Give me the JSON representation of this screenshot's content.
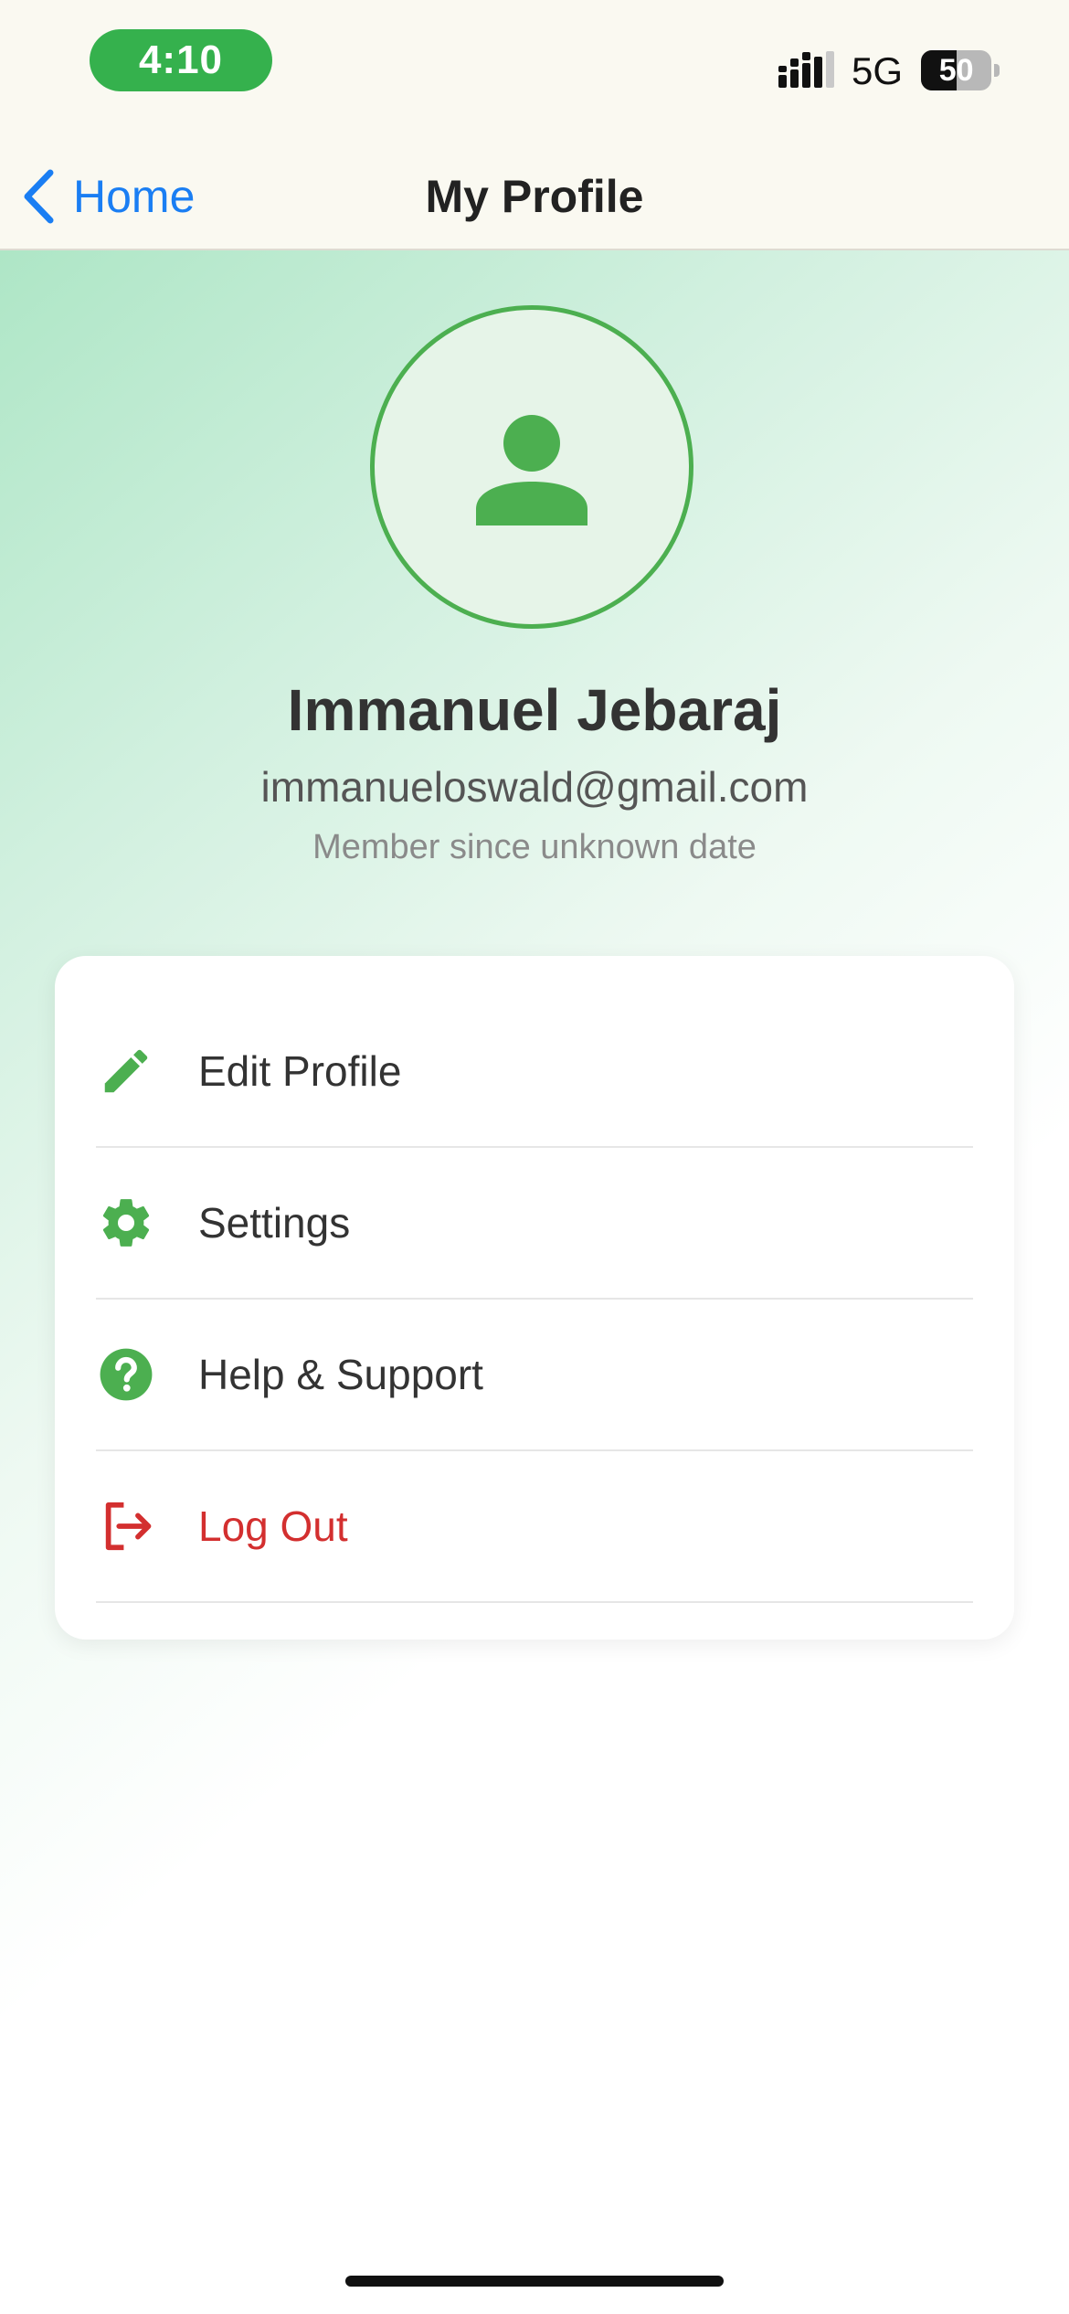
{
  "status_bar": {
    "time": "4:10",
    "network": "5G",
    "battery_level": "50",
    "battery_fraction": 0.5,
    "signal_icon": "cellular-signal-icon",
    "time_pill_color": "#35b14d"
  },
  "nav": {
    "back_label": "Home",
    "back_icon": "chevron-left-icon",
    "title": "My Profile",
    "accent_color": "#1a7ef3"
  },
  "profile": {
    "avatar_icon": "person-icon",
    "name": "Immanuel Jebaraj",
    "email": "immanueloswald@gmail.com",
    "member_since": "Member since unknown date",
    "brand_color": "#4caf50"
  },
  "menu": {
    "items": [
      {
        "label": "Edit Profile",
        "icon": "pencil-icon",
        "color": "#4caf50"
      },
      {
        "label": "Settings",
        "icon": "gear-icon",
        "color": "#4caf50"
      },
      {
        "label": "Help & Support",
        "icon": "help-circle-icon",
        "color": "#4caf50"
      },
      {
        "label": "Log Out",
        "icon": "logout-icon",
        "color": "#d32f2f"
      }
    ]
  }
}
